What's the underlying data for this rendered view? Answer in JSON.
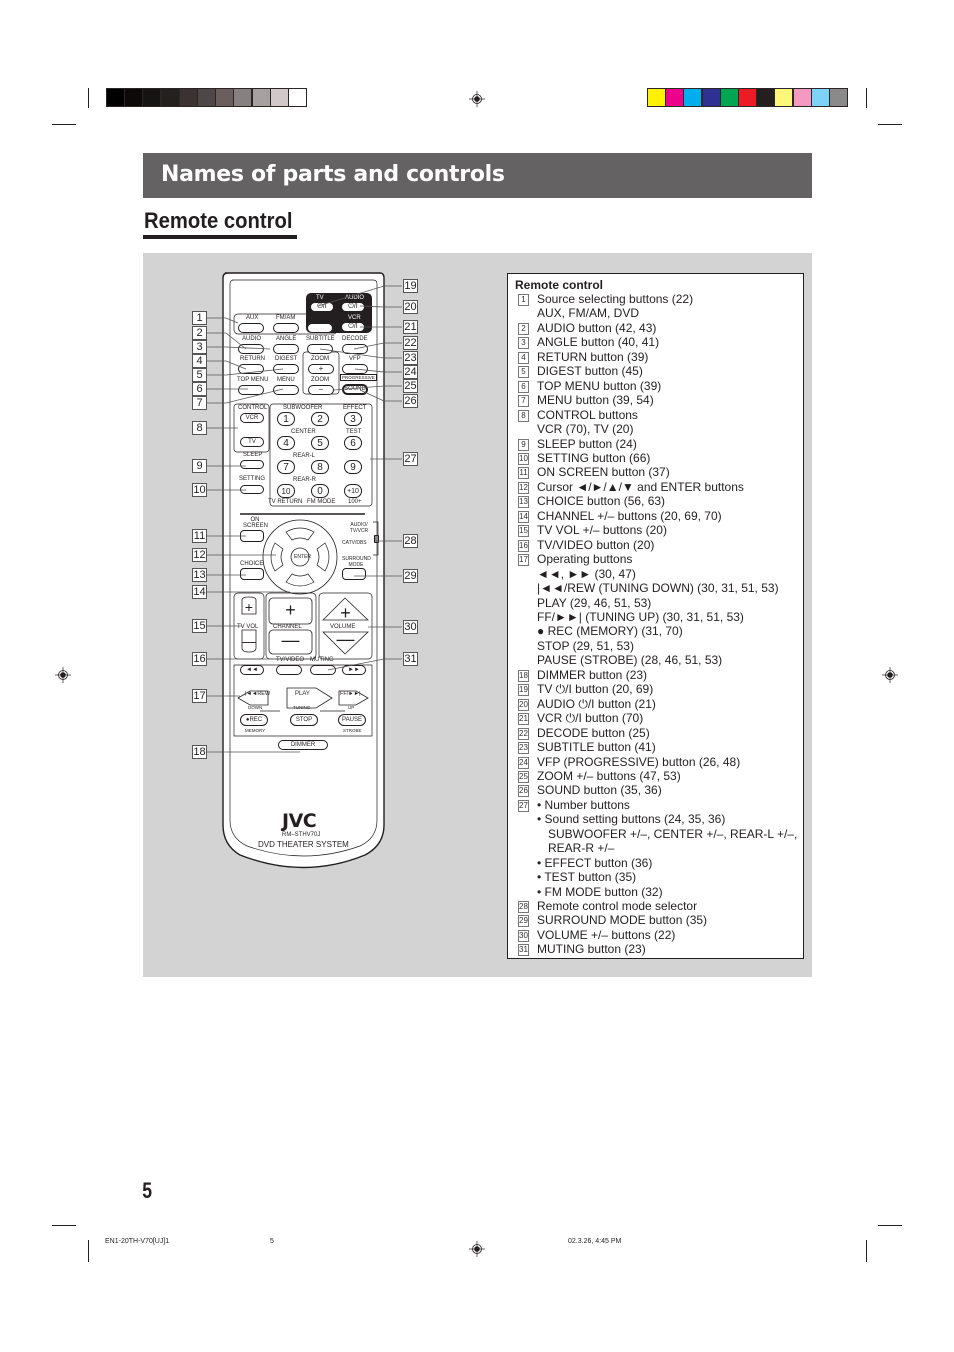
{
  "print_marks": {
    "grayscale_swatches": [
      "#000000",
      "#0b0a09",
      "#161413",
      "#24201e",
      "#3a3332",
      "#4e4748",
      "#6a5f5e",
      "#868080",
      "#a7a0a0",
      "#d1c9c9",
      "#ffffff"
    ],
    "color_swatches": [
      "#fff200",
      "#ec008c",
      "#00aeef",
      "#2e3192",
      "#00a651",
      "#ed1c24",
      "#231f20",
      "#fff77a",
      "#f49ac1",
      "#7dd3f7",
      "#8a8a8a"
    ]
  },
  "header": {
    "banner_title": "Names of parts and controls",
    "section_title": "Remote control"
  },
  "remote": {
    "top_group": {
      "tv": "TV",
      "audio": "AUDIO",
      "vcr": "VCR",
      "power_symbol": "⏻/I"
    },
    "source_buttons": [
      "AUX",
      "FM/AM",
      "DVD"
    ],
    "row2": [
      "AUDIO",
      "ANGLE",
      "SUBTITLE",
      "DECODE"
    ],
    "row3": [
      "RETURN",
      "DIGEST",
      "ZOOM",
      "VFP"
    ],
    "progressive": "PROGRESSIVE",
    "row4": [
      "TOP MENU",
      "MENU",
      "ZOOM"
    ],
    "sound": "SOUND",
    "zoom_plus": "+",
    "zoom_minus": "−",
    "control_label": "CONTROL",
    "control_buttons": [
      "VCR",
      "TV"
    ],
    "sleep": "SLEEP",
    "setting": "SETTING",
    "subwoofer": "SUBWOOFER",
    "effect": "EFFECT",
    "center": "CENTER",
    "test": "TEST",
    "rear_l": "REAR-L",
    "rear_r": "REAR-R",
    "numbers": [
      "1",
      "2",
      "3",
      "4",
      "5",
      "6",
      "7",
      "8",
      "9",
      "10",
      "0",
      "+10"
    ],
    "tv_return": "TV RETURN",
    "fm_mode": "FM MODE",
    "hundred_plus": "100+",
    "on_screen": "ON SCREEN",
    "enter": "ENTER",
    "choice": "CHOICE",
    "mode_selector_top": "AUDIO/ TV/VCR",
    "mode_selector_bottom": "CATV/DBS",
    "surround_mode": "SURROUND MODE",
    "tv_vol": "TV VOL",
    "channel": "CHANNEL",
    "volume": "VOLUME",
    "tv_video": "TV/VIDEO",
    "muting": "MUTING",
    "rew_label": "REW",
    "play": "PLAY",
    "ff_label": "FF/",
    "down": "DOWN",
    "tuning": "TUNING",
    "up": "UP",
    "rec": "●REC",
    "stop": "STOP",
    "pause": "PAUSE",
    "memory": "MEMORY",
    "strobe": "STROBE",
    "dimmer": "DIMMER",
    "brand": "JVC",
    "model": "RM–STHV70J",
    "system": "DVD THEATER SYSTEM"
  },
  "callouts_left": [
    "1",
    "2",
    "3",
    "4",
    "5",
    "6",
    "7",
    "8",
    "9",
    "10",
    "11",
    "12",
    "13",
    "14",
    "15",
    "16",
    "17",
    "18"
  ],
  "callouts_right": [
    "19",
    "20",
    "21",
    "22",
    "23",
    "24",
    "25",
    "26",
    "27",
    "28",
    "29",
    "30",
    "31"
  ],
  "legend": {
    "title": "Remote control",
    "items": [
      {
        "num": "1",
        "lines": [
          "Source selecting buttons (22)",
          "AUX, FM/AM, DVD"
        ]
      },
      {
        "num": "2",
        "lines": [
          "AUDIO button (42, 43)"
        ]
      },
      {
        "num": "3",
        "lines": [
          "ANGLE button (40, 41)"
        ]
      },
      {
        "num": "4",
        "lines": [
          "RETURN button (39)"
        ]
      },
      {
        "num": "5",
        "lines": [
          "DIGEST button (45)"
        ]
      },
      {
        "num": "6",
        "lines": [
          "TOP MENU button (39)"
        ]
      },
      {
        "num": "7",
        "lines": [
          "MENU button (39, 54)"
        ]
      },
      {
        "num": "8",
        "lines": [
          "CONTROL buttons",
          "VCR (70), TV (20)"
        ]
      },
      {
        "num": "9",
        "lines": [
          "SLEEP button (24)"
        ]
      },
      {
        "num": "10",
        "lines": [
          "SETTING button (66)"
        ]
      },
      {
        "num": "11",
        "lines": [
          "ON SCREEN button (37)"
        ]
      },
      {
        "num": "12",
        "lines": [
          "Cursor ◄/►/▲/▼ and ENTER buttons"
        ]
      },
      {
        "num": "13",
        "lines": [
          "CHOICE button (56, 63)"
        ]
      },
      {
        "num": "14",
        "lines": [
          "CHANNEL +/– buttons (20, 69, 70)"
        ]
      },
      {
        "num": "15",
        "lines": [
          "TV VOL +/– buttons (20)"
        ]
      },
      {
        "num": "16",
        "lines": [
          "TV/VIDEO button (20)"
        ]
      },
      {
        "num": "17",
        "lines": [
          "Operating buttons",
          "◄◄, ►► (30, 47)",
          "|◄◄/REW (TUNING DOWN) (30, 31, 51, 53)",
          "PLAY (29, 46, 51, 53)",
          "FF/►►| (TUNING UP) (30, 31, 51, 53)",
          "● REC (MEMORY) (31, 70)",
          "STOP (29, 51, 53)",
          "PAUSE (STROBE) (28, 46, 51, 53)"
        ]
      },
      {
        "num": "18",
        "lines": [
          "DIMMER button (23)"
        ]
      },
      {
        "num": "19",
        "lines": [
          "TV ⏻/I button (20, 69)"
        ]
      },
      {
        "num": "20",
        "lines": [
          "AUDIO ⏻/I button (21)"
        ]
      },
      {
        "num": "21",
        "lines": [
          "VCR ⏻/I button (70)"
        ]
      },
      {
        "num": "22",
        "lines": [
          "DECODE button (25)"
        ]
      },
      {
        "num": "23",
        "lines": [
          "SUBTITLE button (41)"
        ]
      },
      {
        "num": "24",
        "lines": [
          "VFP (PROGRESSIVE) button (26, 48)"
        ]
      },
      {
        "num": "25",
        "lines": [
          "ZOOM +/– buttons (47, 53)"
        ]
      },
      {
        "num": "26",
        "lines": [
          "SOUND button (35, 36)"
        ]
      },
      {
        "num": "27",
        "lines": [
          "• Number buttons",
          "• Sound setting buttons (24, 35, 36)",
          "SUBWOOFER +/–, CENTER +/–, REAR-L +/–,",
          "REAR-R +/–",
          "• EFFECT button (36)",
          "• TEST button (35)",
          "• FM MODE button (32)"
        ]
      },
      {
        "num": "28",
        "lines": [
          "Remote control mode selector"
        ]
      },
      {
        "num": "29",
        "lines": [
          "SURROUND MODE button (35)"
        ]
      },
      {
        "num": "30",
        "lines": [
          "VOLUME +/– buttons (22)"
        ]
      },
      {
        "num": "31",
        "lines": [
          "MUTING button (23)"
        ]
      }
    ]
  },
  "page_number": "5",
  "footer": {
    "left": "EN1-20TH-V70[UJ]1",
    "center": "5",
    "right": "02.3.26, 4:45 PM"
  }
}
